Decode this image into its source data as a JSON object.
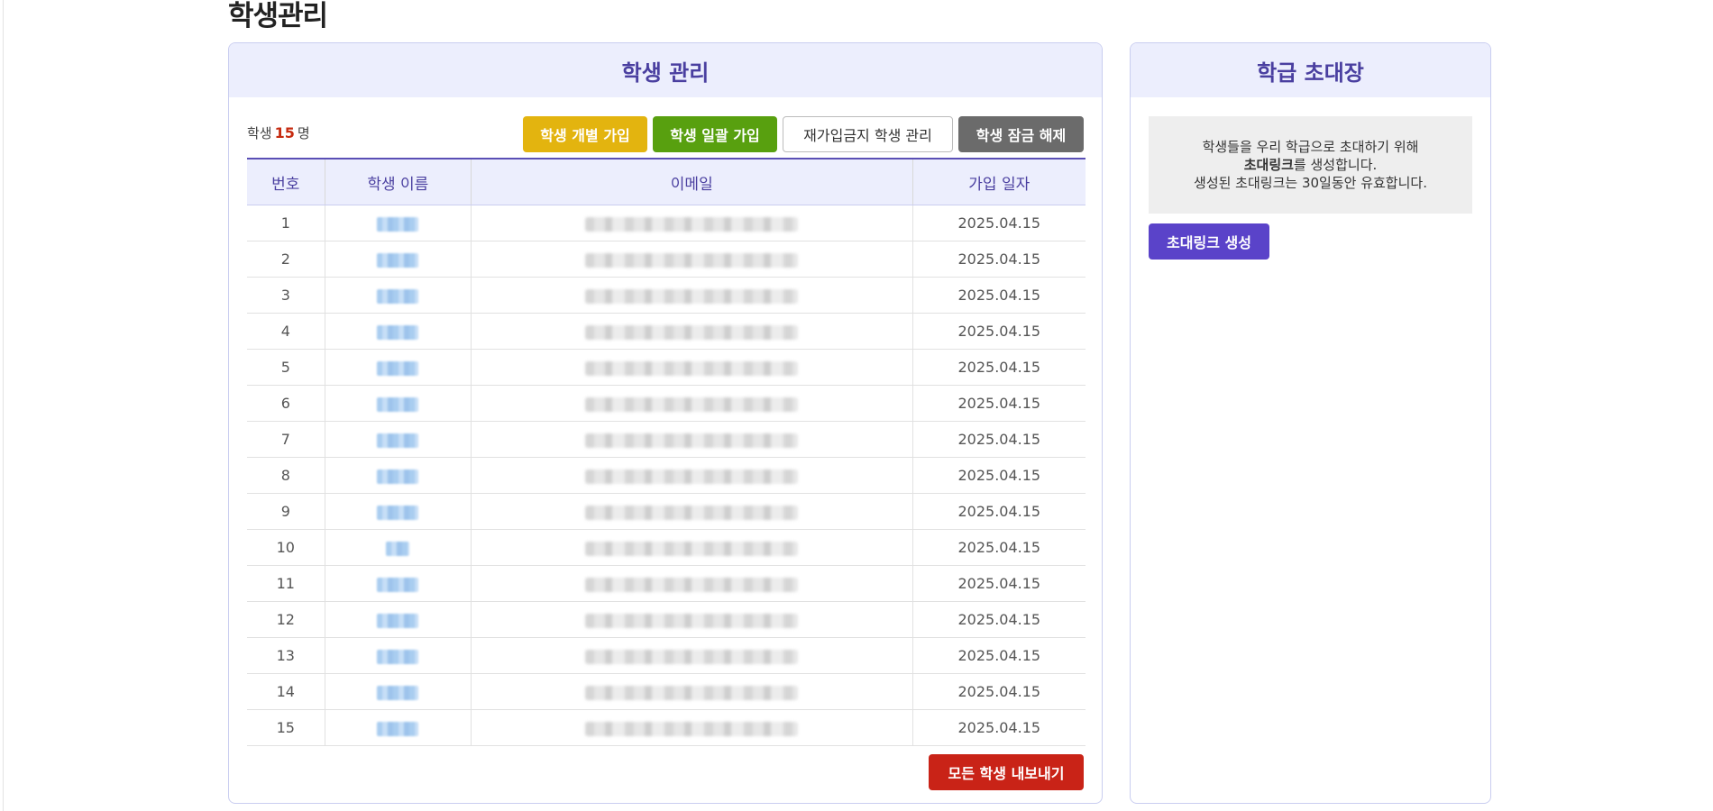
{
  "page_title": "학생관리",
  "main": {
    "header": "학생 관리",
    "count_prefix": "학생",
    "count_value": "15",
    "count_suffix": "명",
    "buttons": {
      "individual": "학생 개별 가입",
      "bulk": "학생 일괄 가입",
      "banned": "재가입금지 학생 관리",
      "unlock": "학생 잠금 해제"
    },
    "table": {
      "headers": [
        "번호",
        "학생 이름",
        "이메일",
        "가입 일자"
      ],
      "rows": [
        {
          "no": "1",
          "date": "2025.04.15"
        },
        {
          "no": "2",
          "date": "2025.04.15"
        },
        {
          "no": "3",
          "date": "2025.04.15"
        },
        {
          "no": "4",
          "date": "2025.04.15"
        },
        {
          "no": "5",
          "date": "2025.04.15"
        },
        {
          "no": "6",
          "date": "2025.04.15"
        },
        {
          "no": "7",
          "date": "2025.04.15"
        },
        {
          "no": "8",
          "date": "2025.04.15"
        },
        {
          "no": "9",
          "date": "2025.04.15"
        },
        {
          "no": "10",
          "date": "2025.04.15"
        },
        {
          "no": "11",
          "date": "2025.04.15"
        },
        {
          "no": "12",
          "date": "2025.04.15"
        },
        {
          "no": "13",
          "date": "2025.04.15"
        },
        {
          "no": "14",
          "date": "2025.04.15"
        },
        {
          "no": "15",
          "date": "2025.04.15"
        }
      ]
    },
    "export_label": "모든 학생 내보내기"
  },
  "side": {
    "header": "학급 초대장",
    "line1": "학생들을 우리 학급으로 초대하기 위해",
    "line2_bold": "초대링크",
    "line2_rest": "를 생성합니다.",
    "line3": "생성된 초대링크는 30일동안 유효합니다.",
    "button_label": "초대링크 생성"
  },
  "colors": {
    "accent": "#4a3fa0",
    "header_bg": "#eceefd",
    "yellow": "#e3b40f",
    "green": "#58a00f",
    "gray": "#6b6b6b",
    "red": "#c92317",
    "purple": "#5a43c9"
  }
}
